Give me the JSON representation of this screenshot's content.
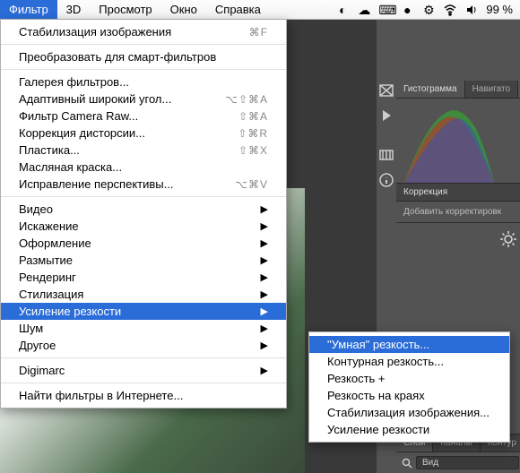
{
  "menubar": {
    "items": [
      "Фильтр",
      "3D",
      "Просмотр",
      "Окно",
      "Справка"
    ],
    "active_index": 0,
    "battery": "99 %"
  },
  "filter_menu": {
    "stabilize": {
      "label": "Стабилизация изображения",
      "shortcut": "⌘F"
    },
    "convert_smart": {
      "label": "Преобразовать для смарт-фильтров"
    },
    "gallery": {
      "label": "Галерея фильтров..."
    },
    "adaptive": {
      "label": "Адаптивный широкий угол...",
      "shortcut": "⌥⇧⌘A"
    },
    "camera_raw": {
      "label": "Фильтр Camera Raw...",
      "shortcut": "⇧⌘A"
    },
    "lens": {
      "label": "Коррекция дисторсии...",
      "shortcut": "⇧⌘R"
    },
    "liquify": {
      "label": "Пластика...",
      "shortcut": "⇧⌘X"
    },
    "oil": {
      "label": "Масляная краска..."
    },
    "vanishing": {
      "label": "Исправление перспективы...",
      "shortcut": "⌥⌘V"
    },
    "video": {
      "label": "Видео"
    },
    "distort": {
      "label": "Искажение"
    },
    "render_style": {
      "label": "Оформление"
    },
    "blur": {
      "label": "Размытие"
    },
    "rendering": {
      "label": "Рендеринг"
    },
    "stylize": {
      "label": "Стилизация"
    },
    "sharpen": {
      "label": "Усиление резкости"
    },
    "noise": {
      "label": "Шум"
    },
    "other": {
      "label": "Другое"
    },
    "digimarc": {
      "label": "Digimarc"
    },
    "find_online": {
      "label": "Найти фильтры в Интернете..."
    }
  },
  "sharpen_submenu": {
    "smart": "\"Умная\" резкость...",
    "contour": "Контурная резкость...",
    "sharpen_plus": "Резкость +",
    "edges": "Резкость на краях",
    "stabilize": "Стабилизация изображения...",
    "sharpen": "Усиление резкости"
  },
  "panels": {
    "histogram_tabs": [
      "Гистограмма",
      "Навигато"
    ],
    "correction": "Коррекция",
    "correction_sub": "Добавить корректировк",
    "layers_tabs": [
      "Слои",
      "Каналы",
      "Контур"
    ],
    "layers_search_label": "Вид"
  }
}
